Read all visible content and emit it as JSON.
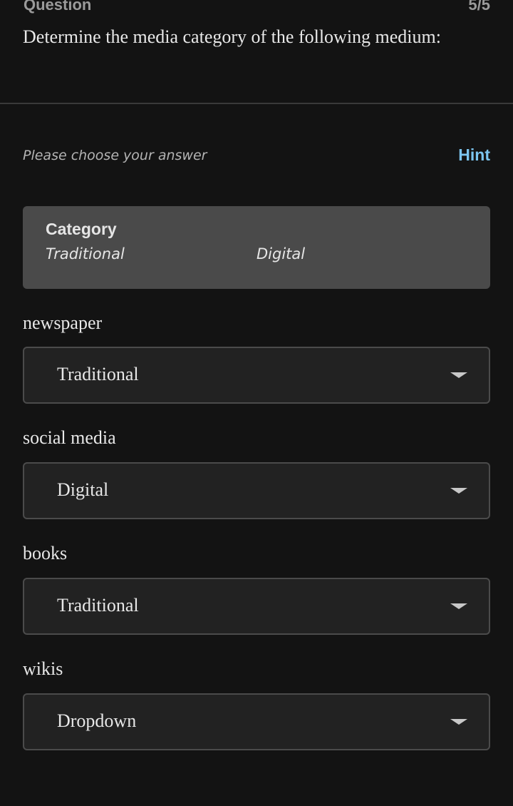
{
  "header": {
    "label": "Question",
    "count": "5/5",
    "text": "Determine the media category of the following medium:"
  },
  "prompt": {
    "choose": "Please choose your answer",
    "hint": "Hint"
  },
  "category": {
    "title": "Category",
    "options": [
      "Traditional",
      "Digital"
    ]
  },
  "items": [
    {
      "label": "newspaper",
      "value": "Traditional"
    },
    {
      "label": "social media",
      "value": "Digital"
    },
    {
      "label": "books",
      "value": "Traditional"
    },
    {
      "label": "wikis",
      "value": "Dropdown"
    }
  ],
  "colors": {
    "background": "#131313",
    "hint": "#7cc6f0",
    "category_box": "#4a4a4a",
    "select_bg": "#222222"
  },
  "icons": {
    "dropdown": "caret-down-icon"
  }
}
